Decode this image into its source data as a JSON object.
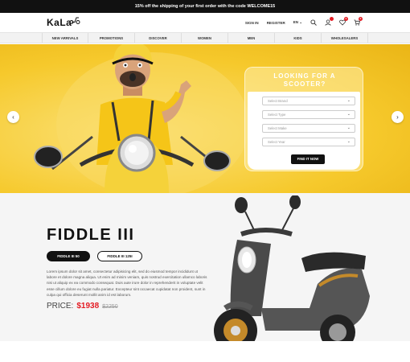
{
  "topbar": {
    "promo_text": "15% off the shipping of your first order with the code WELCOME15"
  },
  "header": {
    "logo_text": "KaLa",
    "links": {
      "sign_in": "SIGN IN",
      "register": "REGISTER",
      "language": "EN"
    },
    "wishlist_count": "0",
    "cart_count": "0"
  },
  "nav": {
    "items": [
      "NEW ARRIVALS",
      "PROMOTIONS",
      "DISCOVER",
      "WOMEN",
      "MEN",
      "KIDS",
      "WHOLESALERS"
    ]
  },
  "hero": {
    "finder": {
      "title_line1": "LOOKING FOR A",
      "title_line2": "SCOOTER?",
      "selects": [
        "Select Brand",
        "Select Type",
        "Select Make",
        "Select Year"
      ],
      "button": "FIND IT NOW"
    }
  },
  "product": {
    "name": "FIDDLE III",
    "variants": [
      "FIDDLE III 50",
      "FIDDLE III 125I"
    ],
    "description": "Lorem ipsum dolor sit amet, consectetur adipisicing elit, sed do eiusmod tempor incididunt ut labore et dolore magna aliqua. Ut enim ad minim veniam, quis nostrud exercitation ullamco laboris nisi ut aliquip ex ea commodo consequat. Duis aute irure dolor in reprehenderit in voluptate velit esse cillum dolore eu fugiat nulla pariatur. Excepteur sint occaecat cupidatat non proident, sunt in culpa qui officia deserunt mollit anim id est laborum.",
    "price_label": "PRICE:",
    "price": "$1938",
    "old_price": "$2250"
  },
  "colors": {
    "accent_yellow": "#f7cf3c",
    "price_red": "#e31b23",
    "dark": "#111111"
  }
}
